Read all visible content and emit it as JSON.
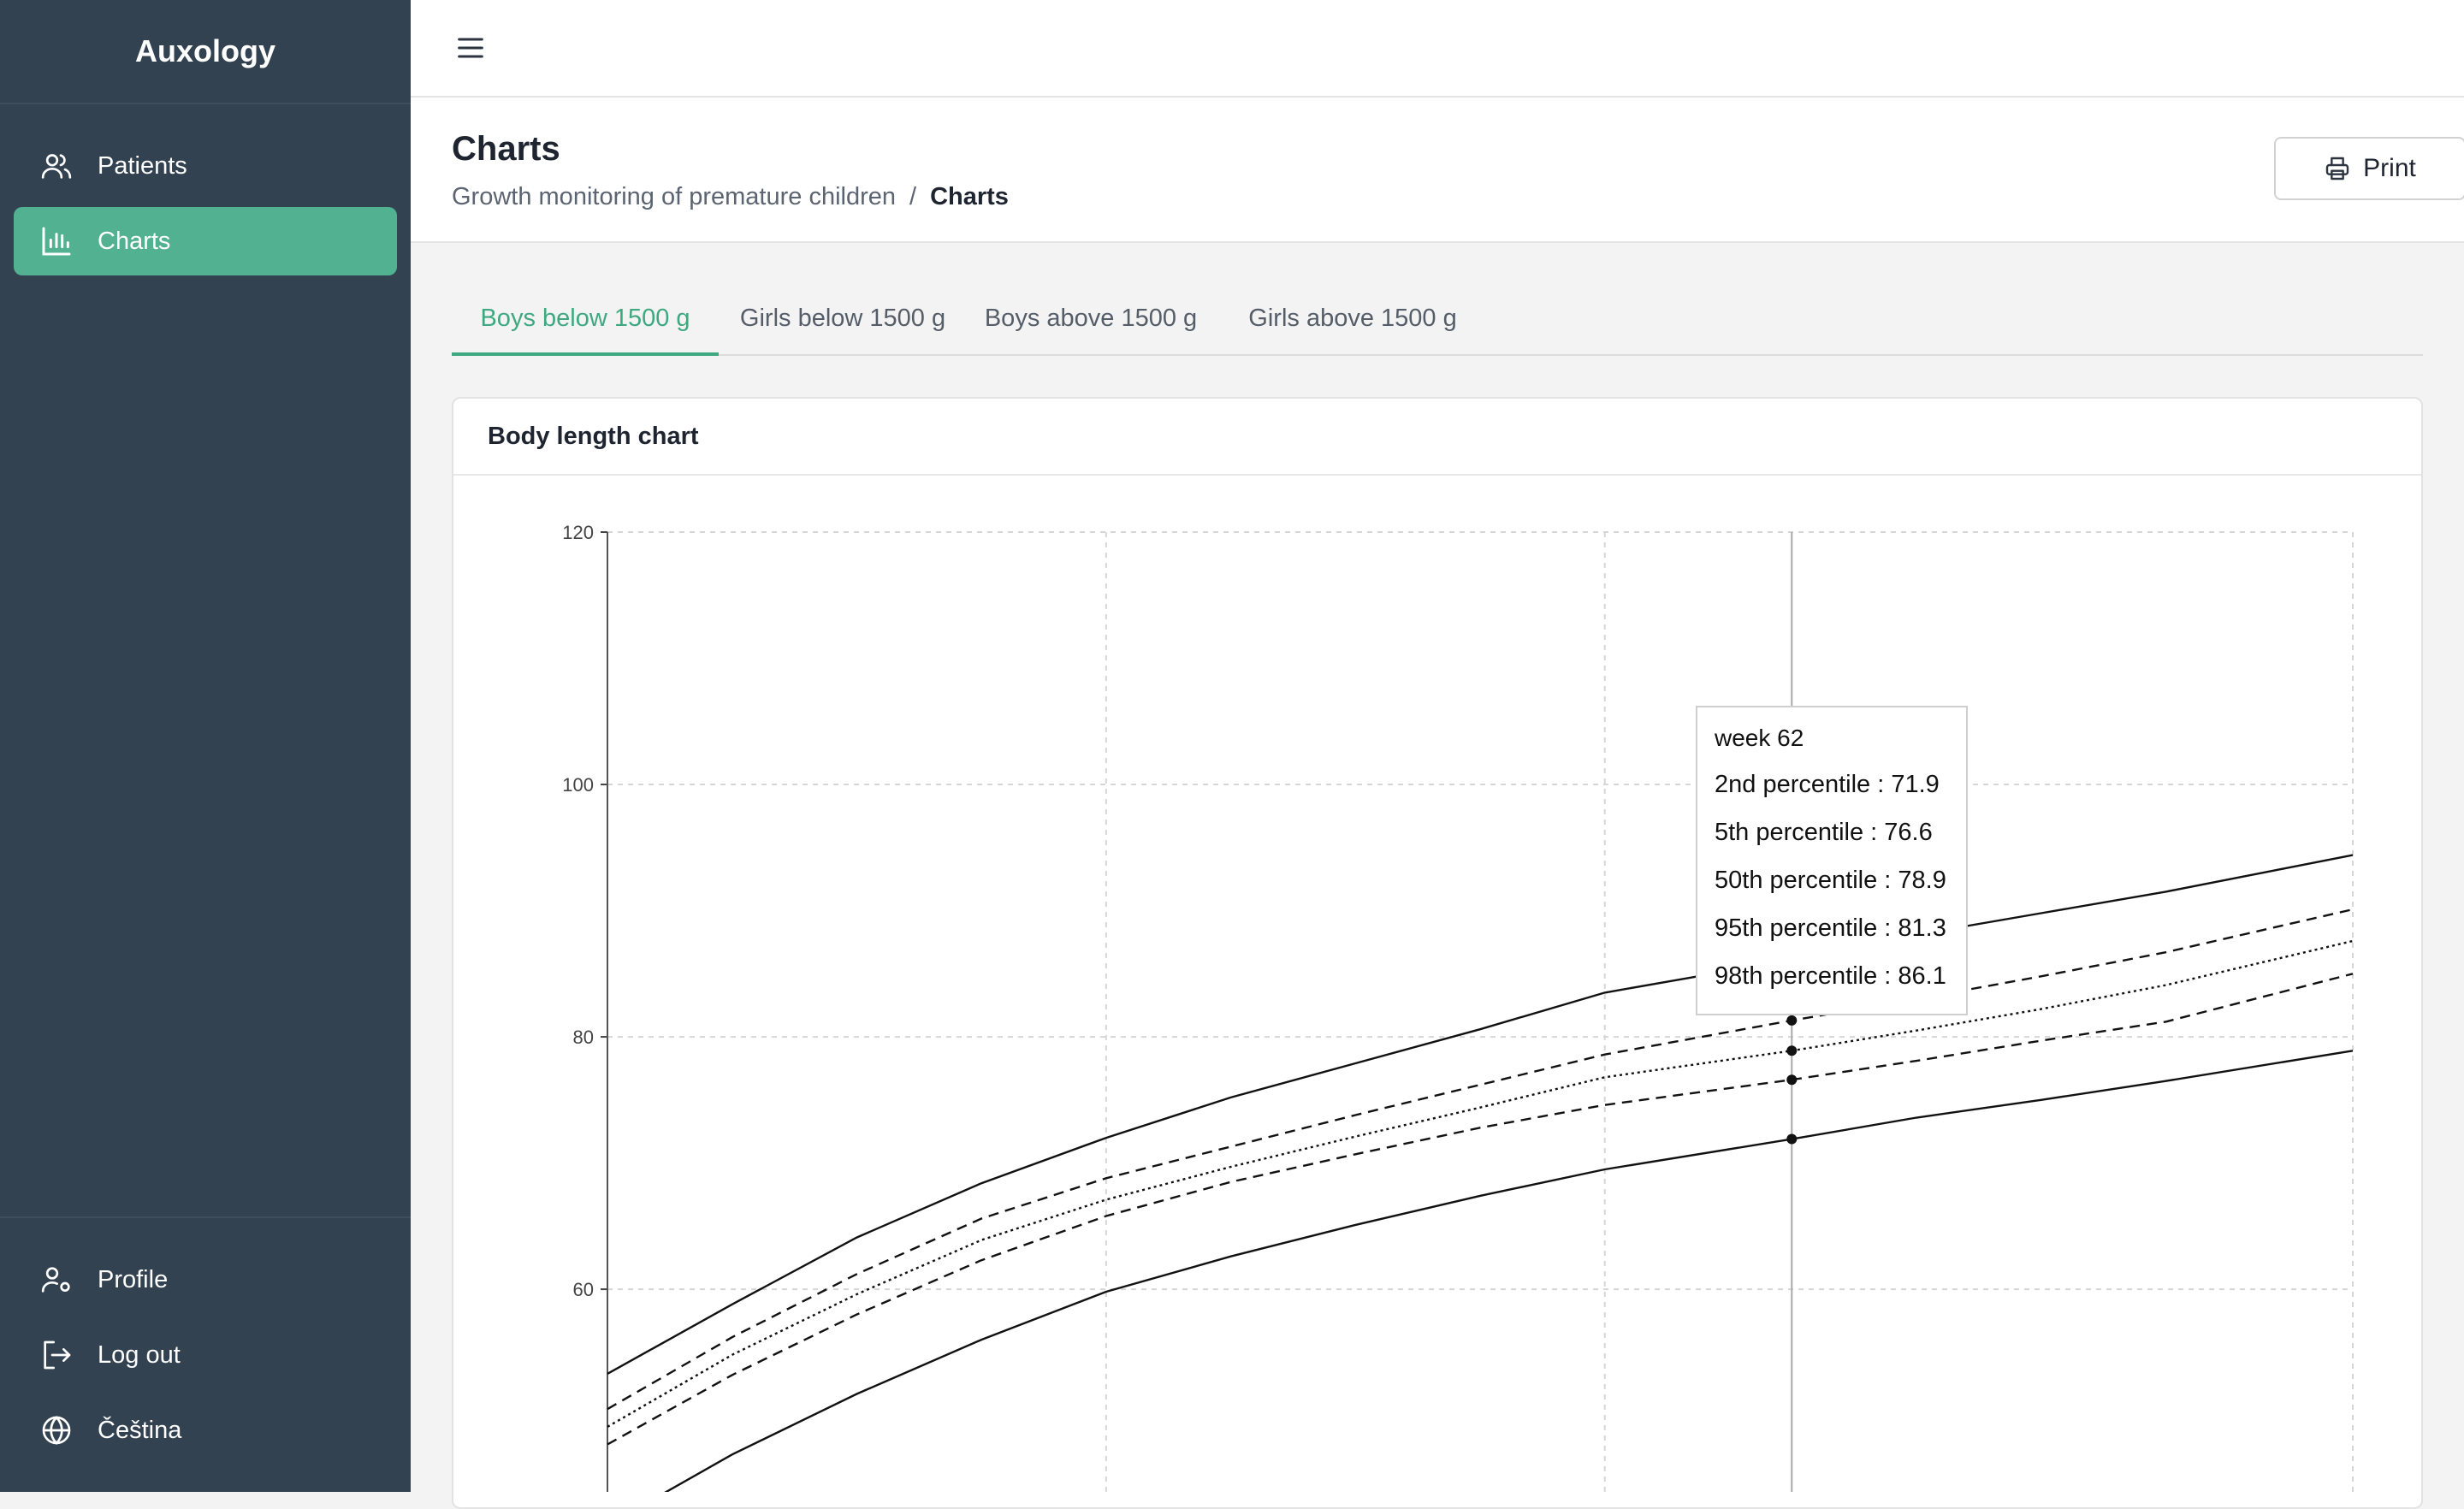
{
  "app": {
    "title": "Auxology"
  },
  "sidebar": {
    "items": [
      {
        "label": "Patients",
        "icon": "users-icon",
        "active": false
      },
      {
        "label": "Charts",
        "icon": "bar-chart-icon",
        "active": true
      }
    ],
    "bottom_items": [
      {
        "label": "Profile",
        "icon": "user-settings-icon"
      },
      {
        "label": "Log out",
        "icon": "logout-icon"
      },
      {
        "label": "Čeština",
        "icon": "globe-icon"
      }
    ]
  },
  "header": {
    "title": "Charts",
    "breadcrumb": {
      "parent": "Growth monitoring of premature children",
      "separator": "/",
      "current": "Charts"
    },
    "print_label": "Print"
  },
  "tabs": [
    {
      "label": "Boys below 1500 g",
      "active": true
    },
    {
      "label": "Girls below 1500 g",
      "active": false
    },
    {
      "label": "Boys above 1500 g",
      "active": false
    },
    {
      "label": "Girls above 1500 g",
      "active": false
    }
  ],
  "card": {
    "title": "Body length chart"
  },
  "colors": {
    "accent": "#52b191",
    "sidebar": "#334251",
    "active_tab": "#3fa882"
  },
  "chart_data": {
    "type": "line",
    "title": "Body length chart",
    "xlabel": "",
    "ylabel": "",
    "y_ticks": [
      60,
      80,
      100,
      120
    ],
    "ylim": [
      41.5,
      120
    ],
    "xlim": [
      24,
      80
    ],
    "x_gridlines": [
      40,
      56,
      80
    ],
    "grid": true,
    "x": [
      24,
      28,
      32,
      36,
      40,
      44,
      48,
      52,
      56,
      62,
      66,
      70,
      74,
      80
    ],
    "series": [
      {
        "name": "2nd percentile",
        "style": "solid",
        "values": [
          41.3,
          46.9,
          51.7,
          56.0,
          59.8,
          62.6,
          65.1,
          67.4,
          69.5,
          71.9,
          73.6,
          75.0,
          76.5,
          78.9
        ]
      },
      {
        "name": "5th percentile",
        "style": "dashed",
        "values": [
          47.7,
          53.2,
          58.0,
          62.3,
          65.8,
          68.5,
          70.7,
          72.8,
          74.6,
          76.6,
          78.1,
          79.7,
          81.2,
          85.0
        ]
      },
      {
        "name": "50th percentile",
        "style": "dotted",
        "values": [
          49.1,
          54.8,
          59.6,
          63.9,
          67.1,
          69.7,
          72.1,
          74.4,
          76.8,
          78.9,
          80.5,
          82.2,
          84.1,
          87.6
        ]
      },
      {
        "name": "95th percentile",
        "style": "dashed",
        "values": [
          50.5,
          56.2,
          61.2,
          65.6,
          68.8,
          71.3,
          73.8,
          76.2,
          78.6,
          81.3,
          83.0,
          84.8,
          86.7,
          90.1
        ]
      },
      {
        "name": "98th percentile",
        "style": "solid",
        "values": [
          53.3,
          58.8,
          64.1,
          68.4,
          72.0,
          75.2,
          77.9,
          80.6,
          83.5,
          86.1,
          88.1,
          89.8,
          91.5,
          94.4
        ]
      }
    ],
    "tooltip": {
      "header": "week 62",
      "rows": [
        "2nd percentile : 71.9",
        "5th percentile : 76.6",
        "50th percentile : 78.9",
        "95th percentile : 81.3",
        "98th percentile : 86.1"
      ]
    },
    "hover_week": 62
  }
}
